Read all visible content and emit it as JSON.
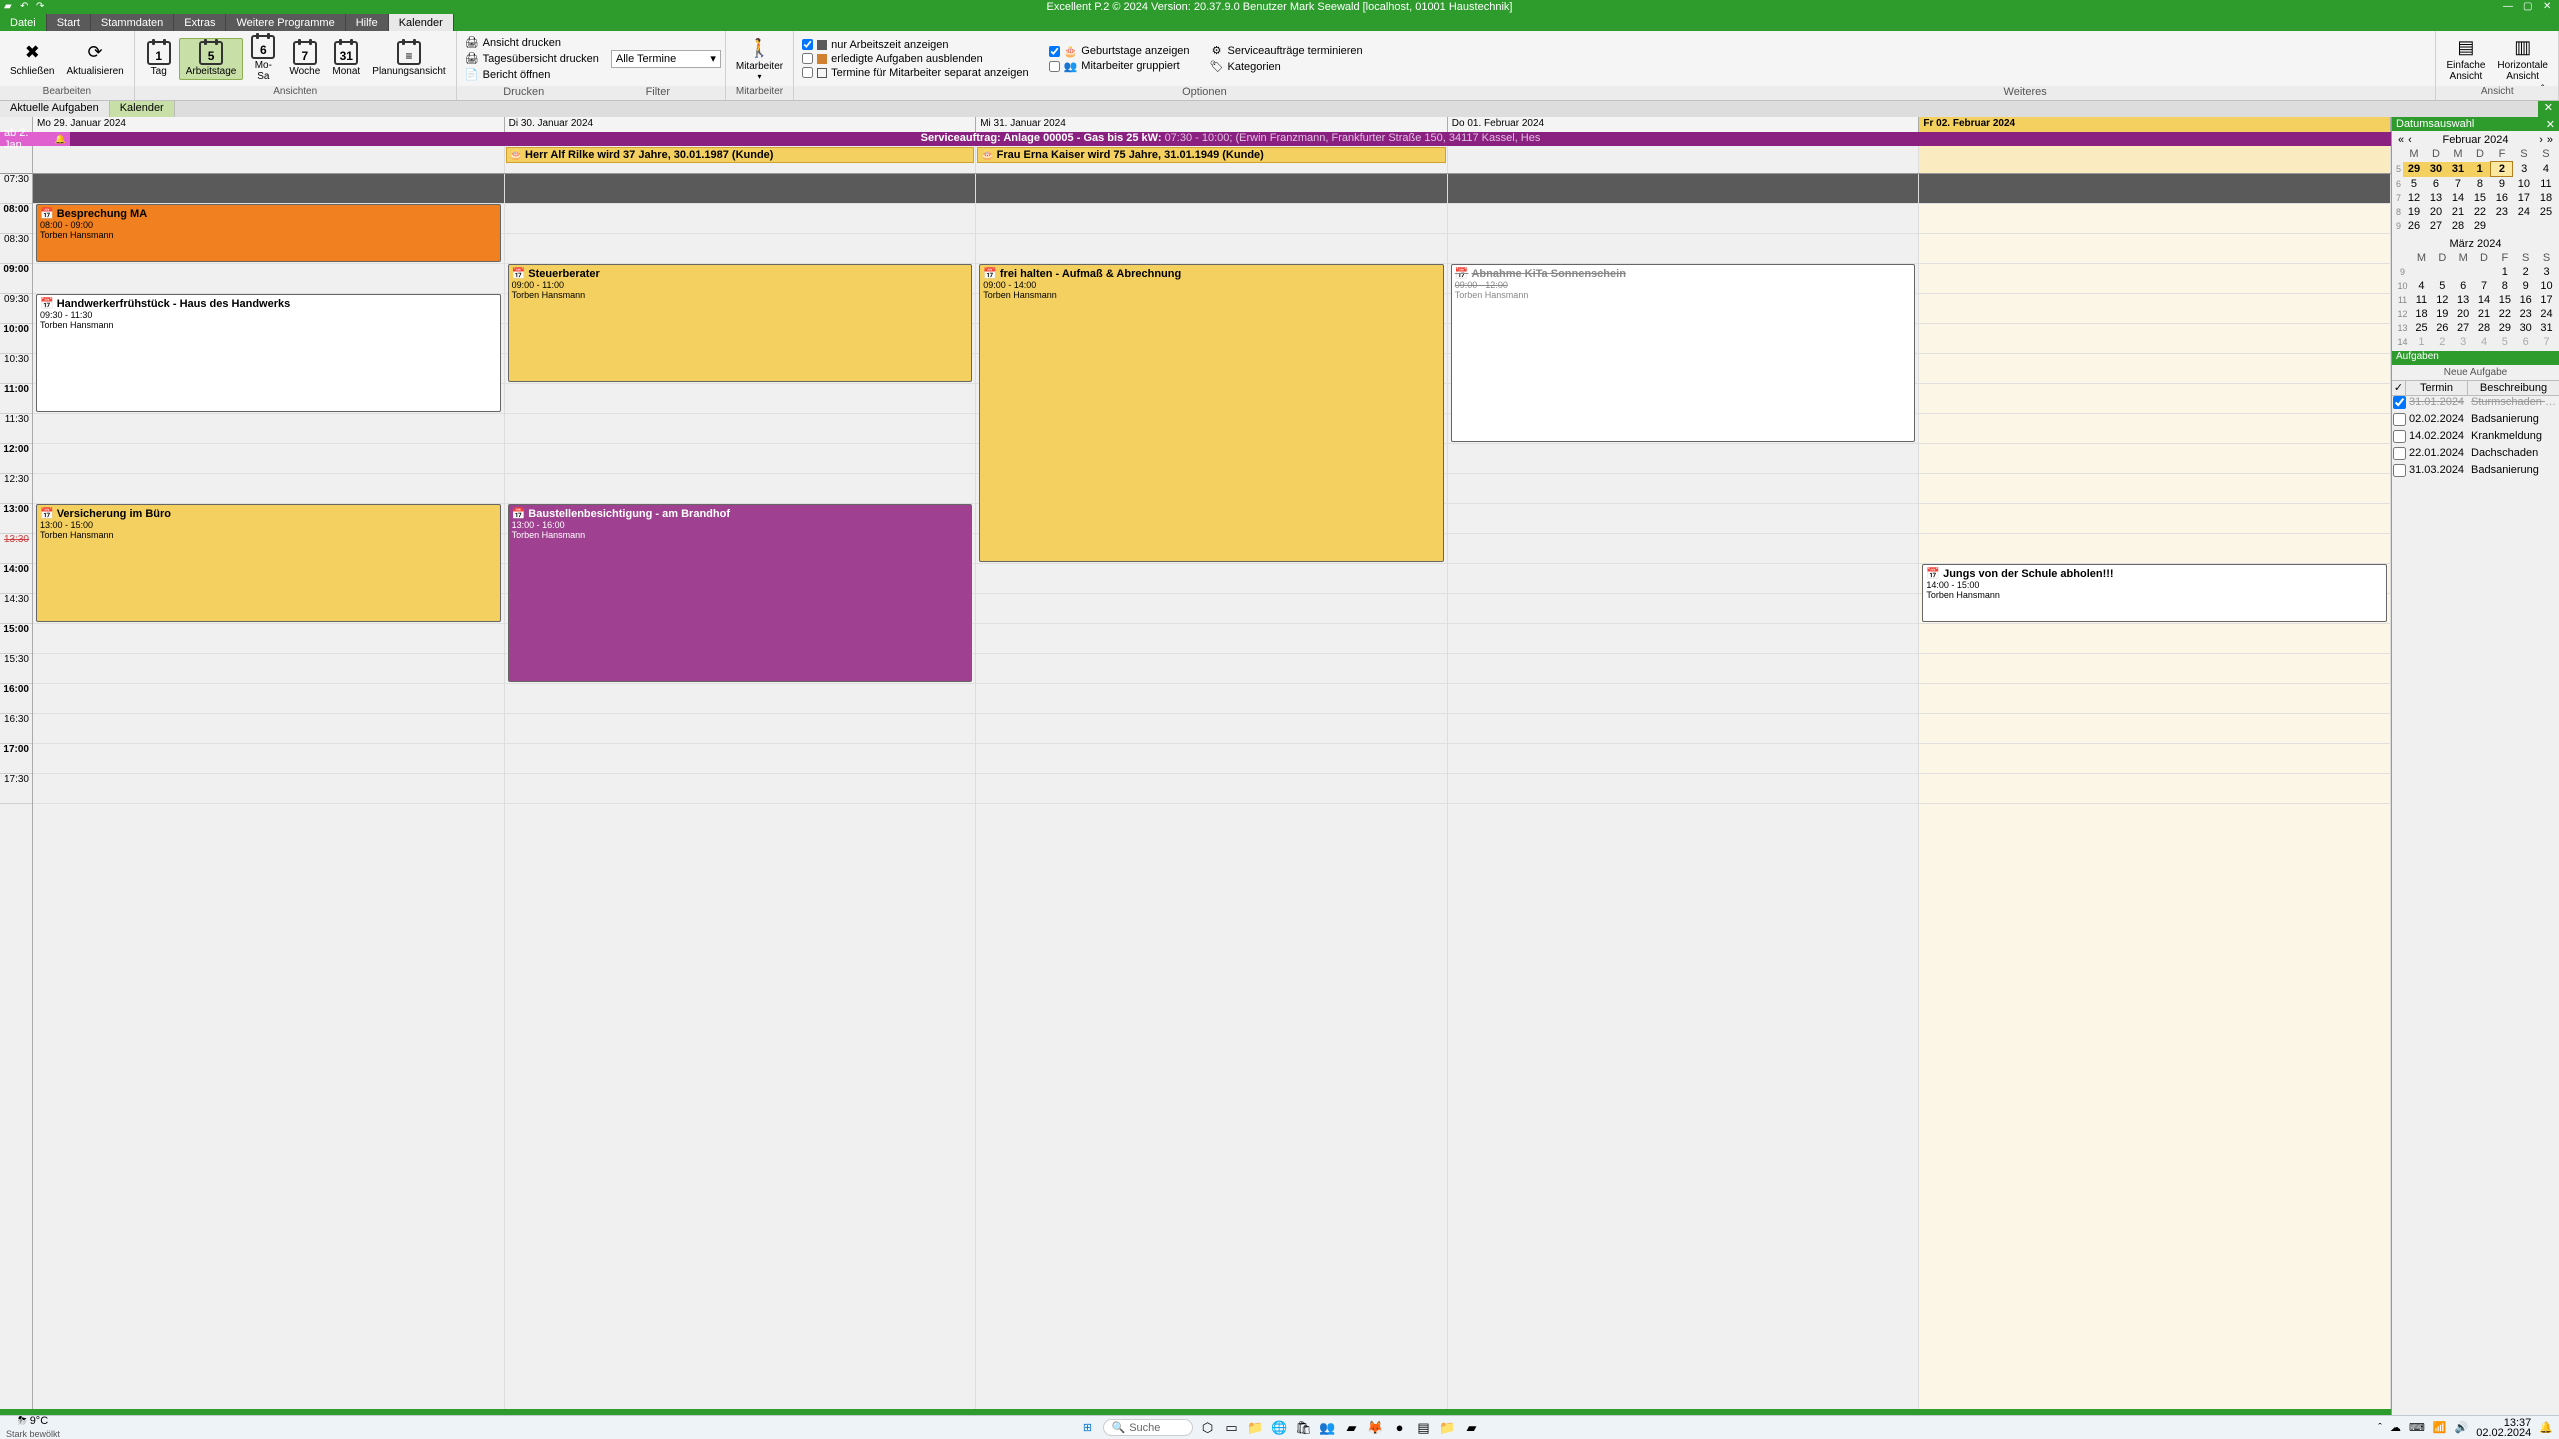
{
  "window": {
    "title": "Excellent P.2 © 2024 Version: 20.37.9.0 Benutzer Mark Seewald [localhost, 01001 Haustechnik]"
  },
  "menu": {
    "datei": "Datei",
    "start": "Start",
    "stammdaten": "Stammdaten",
    "extras": "Extras",
    "weitere": "Weitere Programme",
    "hilfe": "Hilfe",
    "kalender": "Kalender"
  },
  "ribbon": {
    "bearbeiten": {
      "label": "Bearbeiten",
      "schliessen": "Schließen",
      "aktualisieren": "Aktualisieren"
    },
    "ansichten": {
      "label": "Ansichten",
      "tag": "Tag",
      "arbeitstage": "Arbeitstage",
      "mosa": "Mo-\nSa",
      "woche": "Woche",
      "monat": "Monat",
      "planung": "Planungsansicht"
    },
    "drucken": {
      "label": "Drucken",
      "ansicht_drucken": "Ansicht drucken",
      "tagesuebersicht": "Tagesübersicht drucken",
      "bericht": "Bericht öffnen",
      "filter_val": "Alle Termine"
    },
    "filter": {
      "label": "Filter"
    },
    "mitarbeiter": {
      "label": "Mitarbeiter",
      "btn": "Mitarbeiter"
    },
    "optionen": {
      "label": "Optionen",
      "arbeitszeit": "nur Arbeitszeit anzeigen",
      "erledigte": "erledigte Aufgaben ausblenden",
      "separat": "Termine für Mitarbeiter separat anzeigen",
      "geburtstage": "Geburtstage anzeigen",
      "gruppiert": "Mitarbeiter gruppiert",
      "serviceauftraege": "Serviceaufträge terminieren",
      "kategorien": "Kategorien"
    },
    "weiteres": {
      "label": "Weiteres"
    },
    "ansicht": {
      "label": "Ansicht",
      "einfache": "Einfache\nAnsicht",
      "horizontale": "Horizontale\nAnsicht"
    }
  },
  "subtabs": {
    "aufgaben": "Aktuelle Aufgaben",
    "kalender": "Kalender"
  },
  "days": [
    {
      "label": "Mo 29. Januar 2024",
      "current": false
    },
    {
      "label": "Di 30. Januar 2024",
      "current": false
    },
    {
      "label": "Mi 31. Januar 2024",
      "current": false
    },
    {
      "label": "Do 01. Februar 2024",
      "current": false
    },
    {
      "label": "Fr 02. Februar 2024",
      "current": true
    }
  ],
  "svc": {
    "left": "ab 2. Jan.",
    "title": "Serviceauftrag: Anlage  00005 - Gas bis 25 kW:",
    "detail": "07:30 - 10:00; (Erwin Franzmann, Frankfurter Straße 150, 34117 Kassel, Hes"
  },
  "birthdays": {
    "1": "Herr Alf Rilke wird 37 Jahre, 30.01.1987 (Kunde)",
    "2": "Frau Erna Kaiser wird 75 Jahre, 31.01.1949 (Kunde)"
  },
  "times": [
    "07:30",
    "08:00",
    "08:30",
    "09:00",
    "09:30",
    "10:00",
    "10:30",
    "11:00",
    "11:30",
    "12:00",
    "12:30",
    "13:00",
    "13:30",
    "14:00",
    "14:30",
    "15:00",
    "15:30",
    "16:00",
    "16:30",
    "17:00",
    "17:30"
  ],
  "events": {
    "besprechung": {
      "title": "Besprechung MA",
      "time": "08:00 - 09:00",
      "owner": "Torben Hansmann"
    },
    "handwerker": {
      "title": "Handwerkerfrühstück - Haus des Handwerks",
      "time": "09:30 - 11:30",
      "owner": "Torben Hansmann"
    },
    "versicherung": {
      "title": "Versicherung im Büro",
      "time": "13:00 - 15:00",
      "owner": "Torben Hansmann"
    },
    "steuer": {
      "title": "Steuerberater",
      "time": "09:00 - 11:00",
      "owner": "Torben Hansmann"
    },
    "baustelle": {
      "title": "Baustellenbesichtigung - am Brandhof",
      "time": "13:00 - 16:00",
      "owner": "Torben Hansmann"
    },
    "freihalten": {
      "title": "frei halten - Aufmaß & Abrechnung",
      "time": "09:00 - 14:00",
      "owner": "Torben Hansmann"
    },
    "abnahme": {
      "title": "Abnahme KiTa Sonnenschein",
      "time": "09:00 - 12:00",
      "owner": "Torben Hansmann"
    },
    "jungs": {
      "title": "Jungs von der Schule abholen!!!",
      "time": "14:00 - 15:00",
      "owner": "Torben Hansmann"
    }
  },
  "datepanel": {
    "header": "Datumsauswahl",
    "month1": "Februar 2024",
    "month2": "März 2024",
    "wd": [
      "M",
      "D",
      "M",
      "D",
      "F",
      "S",
      "S"
    ]
  },
  "tasks": {
    "header": "Aufgaben",
    "new": "Neue Aufgabe",
    "col_chk": "✓",
    "col_term": "Termin",
    "col_desc": "Beschreibung",
    "rows": [
      {
        "done": true,
        "date": "31.01.2024",
        "desc": "Sturmschaden angucken"
      },
      {
        "done": false,
        "date": "02.02.2024",
        "desc": "Badsanierung"
      },
      {
        "done": false,
        "date": "14.02.2024",
        "desc": "Krankmeldung"
      },
      {
        "done": false,
        "date": "22.01.2024",
        "desc": "Dachschaden"
      },
      {
        "done": false,
        "date": "31.03.2024",
        "desc": "Badsanierung"
      }
    ]
  },
  "taskbar": {
    "temp": "9°C",
    "weather": "Stark bewölkt",
    "search": "Suche",
    "time": "13:37",
    "date": "02.02.2024"
  }
}
